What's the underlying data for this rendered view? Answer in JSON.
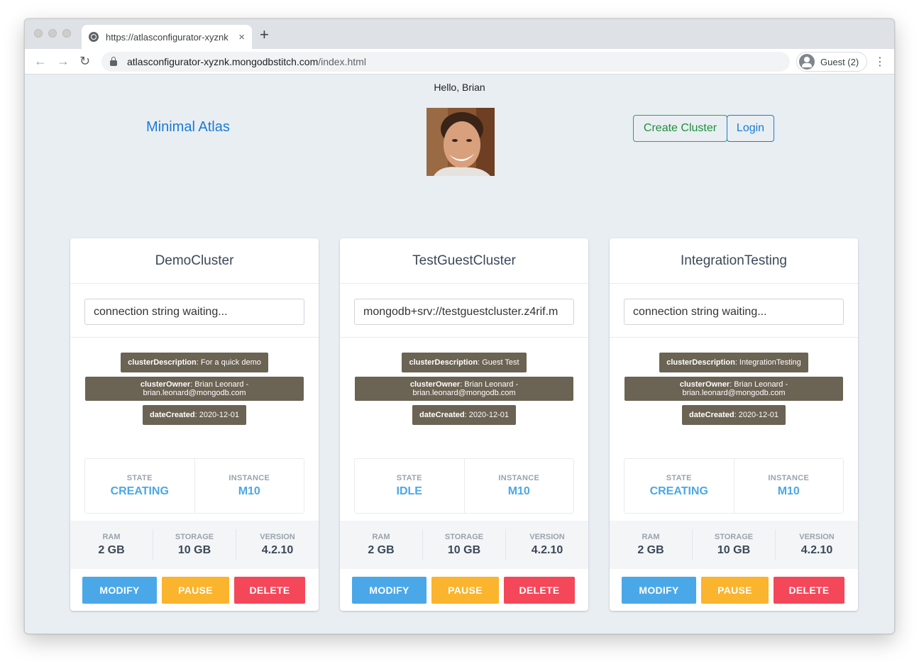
{
  "browser": {
    "tab_title": "https://atlasconfigurator-xyznk",
    "tab_close": "×",
    "new_tab": "+",
    "back": "←",
    "forward": "→",
    "reload": "↻",
    "url_host": "atlasconfigurator-xyznk.mongodbstitch.com",
    "url_path": "/index.html",
    "profile_label": "Guest (2)",
    "menu": "⋮"
  },
  "header": {
    "greeting": "Hello, Brian",
    "brand": "Minimal Atlas",
    "create_cluster": "Create Cluster",
    "login": "Login"
  },
  "labels": {
    "description_key": "clusterDescription",
    "owner_key": "clusterOwner",
    "date_key": "dateCreated",
    "state": "STATE",
    "instance": "INSTANCE",
    "ram": "RAM",
    "storage": "STORAGE",
    "version": "VERSION",
    "modify": "MODIFY",
    "pause": "PAUSE",
    "delete": "DELETE"
  },
  "clusters": [
    {
      "name": "DemoCluster",
      "connection": "connection string waiting...",
      "description": ": For a quick demo",
      "owner": ": Brian Leonard - brian.leonard@mongodb.com",
      "date": ": 2020-12-01",
      "state": "CREATING",
      "instance": "M10",
      "ram": "2 GB",
      "storage": "10 GB",
      "version": "4.2.10"
    },
    {
      "name": "TestGuestCluster",
      "connection": "mongodb+srv://testguestcluster.z4rif.m",
      "description": ": Guest Test",
      "owner": ": Brian Leonard - brian.leonard@mongodb.com",
      "date": ": 2020-12-01",
      "state": "IDLE",
      "instance": "M10",
      "ram": "2 GB",
      "storage": "10 GB",
      "version": "4.2.10"
    },
    {
      "name": "IntegrationTesting",
      "connection": "connection string waiting...",
      "description": ": IntegrationTesting",
      "owner": ": Brian Leonard - brian.leonard@mongodb.com",
      "date": ": 2020-12-01",
      "state": "CREATING",
      "instance": "M10",
      "ram": "2 GB",
      "storage": "10 GB",
      "version": "4.2.10"
    }
  ],
  "colors": {
    "brand": "#1a7bd6",
    "create": "#28a745",
    "tag_bg": "#6b6353",
    "state": "#4aa8e8",
    "modify": "#4aa8e8",
    "pause": "#fbb42d",
    "delete": "#f4475a"
  }
}
